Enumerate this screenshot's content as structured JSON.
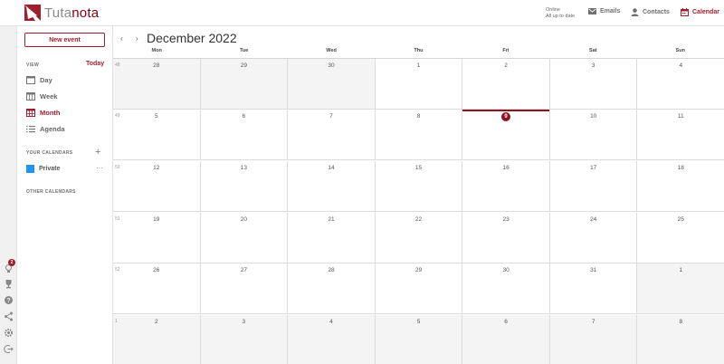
{
  "header": {
    "brand_plain": "Tuta",
    "brand_accent": "nota",
    "status_line1": "Online",
    "status_line2": "All up to date",
    "nav": [
      {
        "label": "Emails",
        "icon": "mail-icon"
      },
      {
        "label": "Contacts",
        "icon": "person-icon"
      },
      {
        "label": "Calendar",
        "icon": "calendar-icon",
        "active": true
      }
    ]
  },
  "sidebar": {
    "new_event_label": "New event",
    "view_heading": "VIEW",
    "today_label": "Today",
    "views": [
      {
        "label": "Day",
        "icon": "day-view-icon"
      },
      {
        "label": "Week",
        "icon": "week-view-icon"
      },
      {
        "label": "Month",
        "icon": "month-view-icon",
        "active": true
      },
      {
        "label": "Agenda",
        "icon": "agenda-list-icon"
      }
    ],
    "your_calendars_heading": "YOUR CALENDARS",
    "add_calendar_label": "+",
    "calendars": [
      {
        "name": "Private",
        "color": "#2196f3",
        "menu_label": "···"
      }
    ],
    "other_calendars_heading": "OTHER CALENDARS"
  },
  "rail": {
    "notification_count": "2",
    "icons": [
      "lightbulb-icon",
      "trophy-icon",
      "help-icon",
      "share-icon",
      "settings-icon",
      "logout-icon"
    ]
  },
  "calendar": {
    "prev_label": "‹",
    "next_label": "›",
    "month_title": "December 2022",
    "weekdays": [
      "Mon",
      "Tue",
      "Wed",
      "Thu",
      "Fri",
      "Sat",
      "Sun"
    ],
    "weeks": [
      {
        "number": "48",
        "days": [
          {
            "n": "28",
            "other": true
          },
          {
            "n": "29",
            "other": true
          },
          {
            "n": "30",
            "other": true
          },
          {
            "n": "1"
          },
          {
            "n": "2"
          },
          {
            "n": "3"
          },
          {
            "n": "4"
          }
        ]
      },
      {
        "number": "49",
        "days": [
          {
            "n": "5"
          },
          {
            "n": "6"
          },
          {
            "n": "7"
          },
          {
            "n": "8"
          },
          {
            "n": "9",
            "today": true
          },
          {
            "n": "10"
          },
          {
            "n": "11"
          }
        ]
      },
      {
        "number": "50",
        "days": [
          {
            "n": "12"
          },
          {
            "n": "13"
          },
          {
            "n": "14"
          },
          {
            "n": "15"
          },
          {
            "n": "16"
          },
          {
            "n": "17"
          },
          {
            "n": "18"
          }
        ]
      },
      {
        "number": "51",
        "days": [
          {
            "n": "19"
          },
          {
            "n": "20"
          },
          {
            "n": "21"
          },
          {
            "n": "22"
          },
          {
            "n": "23"
          },
          {
            "n": "24"
          },
          {
            "n": "25"
          }
        ]
      },
      {
        "number": "52",
        "days": [
          {
            "n": "26"
          },
          {
            "n": "27"
          },
          {
            "n": "28"
          },
          {
            "n": "29"
          },
          {
            "n": "30"
          },
          {
            "n": "31"
          },
          {
            "n": "1",
            "other": true
          }
        ]
      },
      {
        "number": "1",
        "days": [
          {
            "n": "2",
            "other": true
          },
          {
            "n": "3",
            "other": true
          },
          {
            "n": "4",
            "other": true
          },
          {
            "n": "5",
            "other": true
          },
          {
            "n": "6",
            "other": true
          },
          {
            "n": "7",
            "other": true
          },
          {
            "n": "8",
            "other": true
          }
        ]
      }
    ]
  },
  "colors": {
    "accent": "#a01f2f",
    "today_marker": "#8f1423",
    "other_month_bg": "#f4f4f4"
  }
}
